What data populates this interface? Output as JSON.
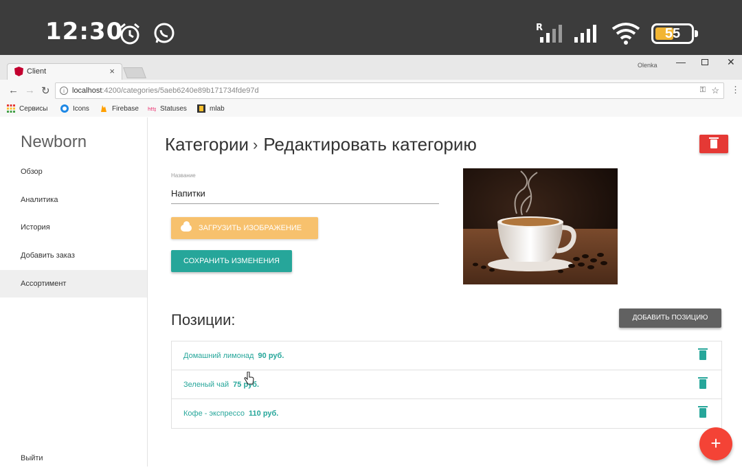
{
  "status_bar": {
    "time": "12:30",
    "signal_label": "R",
    "battery": "55"
  },
  "browser": {
    "tab_title": "Client",
    "tab_close": "×",
    "window_user": "Olenka",
    "url_host": "localhost",
    "url_path": ":4200/categories/5aeb6240e89b171734fde97d",
    "bookmarks": [
      {
        "label": "Сервисы"
      },
      {
        "label": "Icons"
      },
      {
        "label": "Firebase"
      },
      {
        "label": "Statuses"
      },
      {
        "label": "mlab"
      }
    ]
  },
  "sidebar": {
    "brand": "Newborn",
    "items": [
      {
        "label": "Обзор"
      },
      {
        "label": "Аналитика"
      },
      {
        "label": "История"
      },
      {
        "label": "Добавить заказ"
      },
      {
        "label": "Ассортимент"
      }
    ],
    "logout": "Выйти"
  },
  "main": {
    "breadcrumb_parent": "Категории",
    "breadcrumb_separator": "›",
    "breadcrumb_current": "Редактировать категорию",
    "field_label": "Название",
    "field_value": "Напитки",
    "upload_button": "ЗАГРУЗИТЬ ИЗОБРАЖЕНИЕ",
    "save_button": "СОХРАНИТЬ ИЗМЕНЕНИЯ",
    "section_title": "Позиции:",
    "add_button": "ДОБАВИТЬ ПОЗИЦИЮ",
    "fab_label": "+",
    "positions": [
      {
        "name": "Домашний лимонад",
        "price": "90 руб."
      },
      {
        "name": "Зеленый чай",
        "price": "75 руб."
      },
      {
        "name": "Кофе - экспрессо",
        "price": "110 руб."
      }
    ]
  },
  "colors": {
    "teal": "#26a69a",
    "orange": "#f7c16d",
    "red": "#e53935",
    "gray": "#616161"
  }
}
